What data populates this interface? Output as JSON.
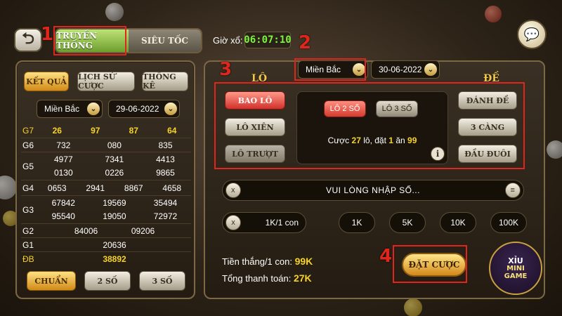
{
  "annotations": {
    "tabs": "1",
    "region": "2",
    "bet_types": "3",
    "place_bet": "4"
  },
  "header": {
    "tabs": [
      {
        "label": "TRUYỀN THỐNG",
        "active": true
      },
      {
        "label": "SIÊU TỐC",
        "active": false
      }
    ],
    "draw_label": "Giờ xổ:",
    "draw_time": "06:07:10"
  },
  "left": {
    "buttons": [
      "KẾT QUẢ",
      "LỊCH SỬ CƯỢC",
      "THỐNG KÊ"
    ],
    "region": "Miền Bắc",
    "date": "29-06-2022",
    "results": [
      {
        "label": "G7",
        "values": [
          "26",
          "97",
          "87",
          "64"
        ],
        "highlight": true
      },
      {
        "label": "G6",
        "values": [
          "732",
          "080",
          "835"
        ]
      },
      {
        "label": "G5",
        "values": [
          "4977",
          "7341",
          "4413",
          "0130",
          "0226",
          "9865"
        ]
      },
      {
        "label": "G4",
        "values": [
          "0653",
          "2941",
          "8867",
          "4658"
        ]
      },
      {
        "label": "G3",
        "values": [
          "67842",
          "19569",
          "35494",
          "95540",
          "19050",
          "72972"
        ]
      },
      {
        "label": "G2",
        "values": [
          "84006",
          "09206"
        ]
      },
      {
        "label": "G1",
        "values": [
          "20636"
        ]
      },
      {
        "label": "ĐB",
        "values": [
          "38892"
        ],
        "highlight": true
      }
    ],
    "modes": [
      "CHUẨN",
      "2 SỐ",
      "3 SỐ"
    ]
  },
  "right": {
    "region": "Miền Bắc",
    "date": "30-06-2022",
    "lo_title": "LÔ",
    "de_title": "ĐỀ",
    "lo_buttons": [
      "BAO LÔ",
      "LÔ XIÊN",
      "LÔ TRƯỢT"
    ],
    "de_buttons": [
      "ĐÁNH ĐỀ",
      "3 CÀNG",
      "ĐẦU ĐUÔI"
    ],
    "sub_options": [
      "LÔ 2 SỐ",
      "LÔ 3 SỐ"
    ],
    "bet_info": {
      "prefix": "Cược",
      "count": "27",
      "mid": "lô, đặt",
      "stake": "1",
      "mid2": "ăn",
      "payout": "99"
    },
    "input_placeholder": "VUI LÒNG NHẬP SỐ...",
    "unit_value": "1K/1 con",
    "chips": [
      "1K",
      "5K",
      "10K",
      "100K"
    ],
    "win_label": "Tiền thắng/1 con:",
    "win_value": "99K",
    "total_label": "Tổng thanh toán:",
    "total_value": "27K",
    "bet_button": "ĐẶT CƯỢC"
  },
  "minigame": {
    "top": "XỈU",
    "line1": "MINI",
    "line2": "GAME"
  },
  "colors": {
    "accent_gold": "#f2c94c",
    "highlight_red": "#e0261c",
    "time_green": "#7ef33b"
  }
}
